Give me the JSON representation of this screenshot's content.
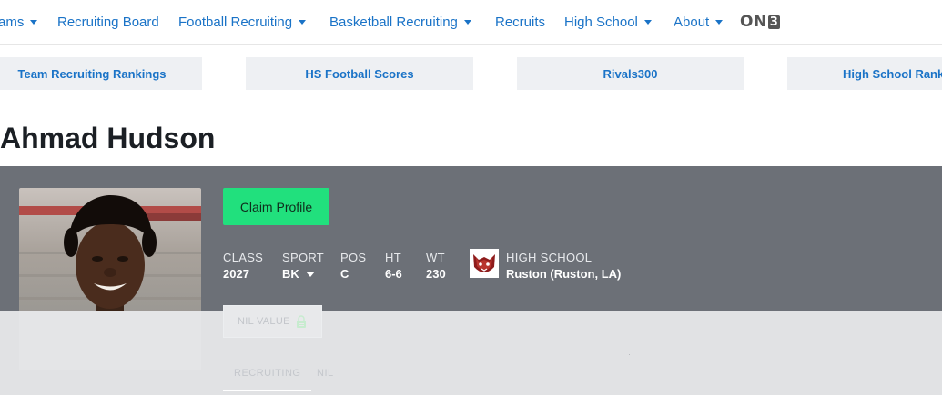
{
  "nav": {
    "items": [
      {
        "label": "ams",
        "has_caret": true
      },
      {
        "label": "Recruiting Board",
        "has_caret": false
      },
      {
        "label": "Football Recruiting",
        "has_caret": true
      },
      {
        "label": "Basketball Recruiting",
        "has_caret": true
      },
      {
        "label": "Recruits",
        "has_caret": false
      },
      {
        "label": "High School",
        "has_caret": true
      },
      {
        "label": "About",
        "has_caret": true
      }
    ],
    "brand_on": "ON",
    "brand_3": "3"
  },
  "quick_links": [
    {
      "label": "Team Recruiting Rankings"
    },
    {
      "label": "HS Football Scores"
    },
    {
      "label": "Rivals300"
    },
    {
      "label": "High School Rankin"
    }
  ],
  "player": {
    "name": "Ahmad Hudson",
    "claim_label": "Claim Profile",
    "stats": {
      "class_label": "CLASS",
      "class_value": "2027",
      "sport_label": "SPORT",
      "sport_value": "BK",
      "pos_label": "POS",
      "pos_value": "C",
      "ht_label": "HT",
      "ht_value": "6-6",
      "wt_label": "WT",
      "wt_value": "230"
    },
    "school_label": "HIGH SCHOOL",
    "school_value": "Ruston (Ruston, LA)",
    "nil_label": "NIL VALUE"
  },
  "tabs": [
    {
      "label": "RECRUITING",
      "active": true
    },
    {
      "label": "NIL",
      "active": false
    }
  ],
  "colors": {
    "link": "#1a73c7",
    "band": "#6c7077",
    "claim": "#21e07d",
    "overlay": "#e1e2e4"
  },
  "icons": [
    "chevron-down-icon",
    "lock-icon",
    "school-mascot-logo",
    "player-photo"
  ]
}
